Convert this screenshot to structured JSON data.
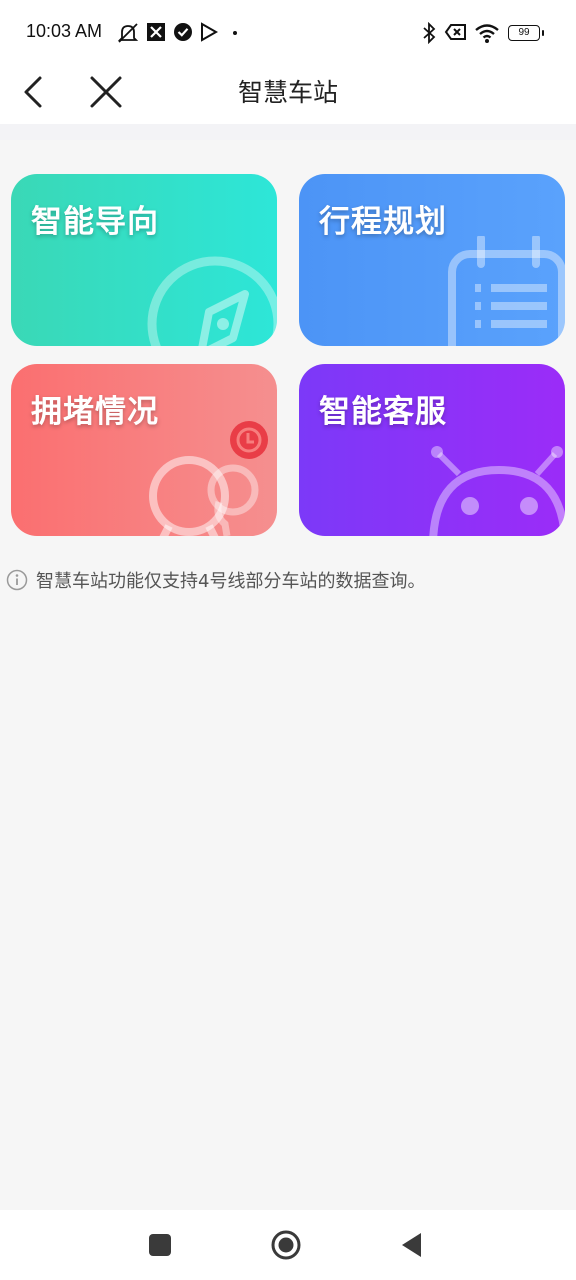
{
  "status_bar": {
    "time": "10:03 AM",
    "battery": "99",
    "icons": [
      "mute-icon",
      "app-icon",
      "check-badge-icon",
      "play-icon",
      "dot-icon",
      "bluetooth-icon",
      "close-box-icon",
      "wifi-icon",
      "battery-icon"
    ]
  },
  "header": {
    "title": "智慧车站",
    "back_icon": "chevron-left-icon",
    "close_icon": "close-icon"
  },
  "cards": [
    {
      "label": "智能导向",
      "icon": "compass-icon",
      "color": "#2ddcc6"
    },
    {
      "label": "行程规划",
      "icon": "calendar-icon",
      "color": "#519bf9"
    },
    {
      "label": "拥堵情况",
      "icon": "crowd-icon",
      "color": "#f77e7e"
    },
    {
      "label": "智能客服",
      "icon": "robot-icon",
      "color": "#8b33f8"
    }
  ],
  "notice": {
    "icon": "info-icon",
    "text": "智慧车站功能仅支持4号线部分车站的数据查询。"
  },
  "nav_bar": {
    "icons": [
      "recents-square-icon",
      "home-circle-icon",
      "back-triangle-icon"
    ]
  }
}
